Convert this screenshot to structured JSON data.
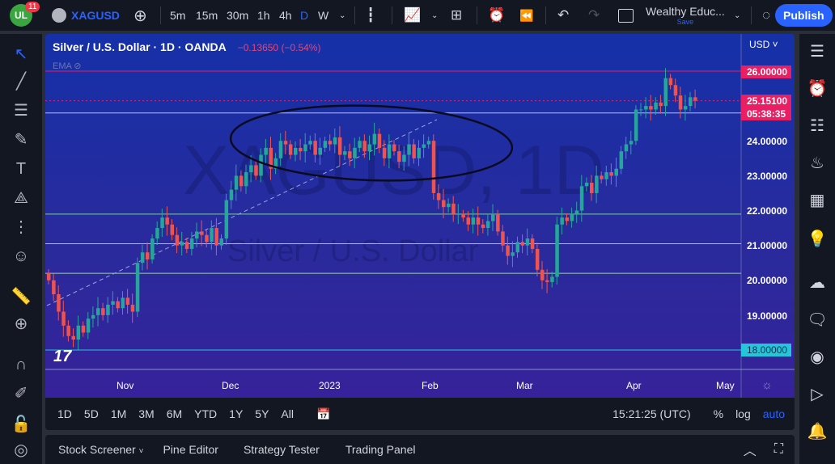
{
  "topbar": {
    "notifications": "11",
    "symbol": "XAGUSD",
    "intervals": [
      "5m",
      "15m",
      "30m",
      "1h",
      "4h",
      "D",
      "W"
    ],
    "active_interval": "D",
    "layout_name": "Wealthy Educ...",
    "save_label": "Save",
    "publish_label": "Publish"
  },
  "legend": {
    "title": "Silver / U.S. Dollar · 1D · OANDA",
    "change": "−0.13650 (−0.54%)",
    "indicator": "EMA"
  },
  "price_axis": {
    "currency": "USD",
    "labels": [
      "26.00000",
      "24.00000",
      "23.00000",
      "22.00000",
      "21.00000",
      "20.00000",
      "19.00000",
      "18.00000"
    ],
    "current_price": "25.15100",
    "countdown": "05:38:35"
  },
  "time_axis": [
    "Nov",
    "Dec",
    "2023",
    "Feb",
    "Mar",
    "Apr",
    "May"
  ],
  "watermark": {
    "symbol": "XAGUSD, 1D",
    "name": "Silver / U.S. Dollar"
  },
  "range_bar": {
    "ranges": [
      "1D",
      "5D",
      "1M",
      "3M",
      "6M",
      "YTD",
      "1Y",
      "5Y",
      "All"
    ],
    "clock": "15:21:25 (UTC)",
    "percent": "%",
    "log": "log",
    "auto": "auto"
  },
  "bottom_panel": {
    "tabs": [
      "Stock Screener",
      "Pine Editor",
      "Strategy Tester",
      "Trading Panel"
    ]
  },
  "colors": {
    "up": "#26a69a",
    "down": "#ef5350",
    "accent": "#2962ff",
    "level": "#e91e63",
    "support": "#00bcd4"
  },
  "chart_data": {
    "type": "candlestick",
    "ylim": [
      17.2,
      27.0
    ],
    "levels": [
      26.0,
      24.8,
      21.9,
      21.05,
      20.2,
      18.0
    ],
    "closes": [
      20.0,
      19.6,
      19.1,
      18.7,
      18.4,
      18.3,
      18.7,
      18.5,
      18.9,
      19.0,
      19.2,
      19.0,
      19.3,
      19.4,
      19.2,
      19.5,
      19.3,
      19.1,
      20.5,
      20.8,
      20.6,
      21.2,
      21.5,
      21.8,
      21.6,
      21.3,
      21.0,
      21.1,
      20.9,
      21.2,
      21.4,
      21.3,
      21.1,
      21.5,
      21.0,
      21.2,
      22.3,
      22.6,
      23.0,
      22.7,
      23.1,
      23.3,
      23.0,
      23.6,
      23.8,
      23.2,
      23.5,
      24.0,
      23.9,
      23.6,
      23.8,
      23.7,
      23.9,
      24.0,
      23.6,
      23.8,
      24.0,
      23.9,
      24.1,
      23.6,
      23.7,
      23.5,
      23.8,
      24.0,
      23.7,
      23.9,
      24.2,
      23.8,
      23.5,
      23.9,
      23.7,
      23.4,
      23.6,
      23.9,
      23.5,
      23.8,
      23.9,
      24.0,
      22.5,
      22.3,
      22.1,
      22.2,
      21.9,
      21.9,
      21.8,
      21.6,
      21.8,
      21.6,
      21.5,
      21.7,
      21.9,
      21.4,
      21.0,
      20.7,
      20.8,
      21.1,
      21.0,
      21.2,
      20.9,
      20.3,
      20.0,
      19.95,
      20.1,
      21.6,
      21.8,
      21.7,
      21.9,
      22.0,
      22.7,
      22.8,
      22.5,
      23.0,
      22.9,
      23.1,
      23.0,
      23.2,
      23.7,
      23.9,
      24.0,
      24.9,
      24.9,
      25.0,
      24.9,
      25.1,
      25.0,
      25.8,
      25.6,
      25.3,
      24.9,
      25.0,
      25.25,
      25.15
    ]
  }
}
